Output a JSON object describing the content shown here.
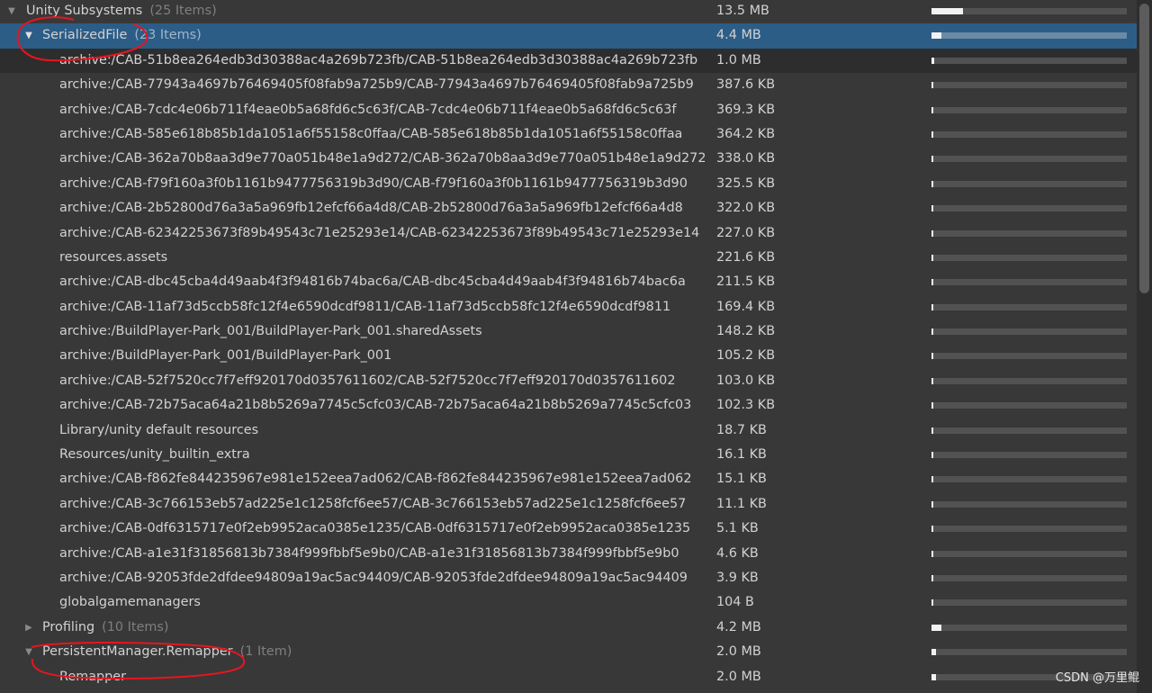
{
  "root": {
    "label": "Unity Subsystems",
    "count": "(25 Items)",
    "size": "13.5 MB",
    "usage": 0.16
  },
  "serialized": {
    "label": "SerializedFile",
    "count": "(23 Items)",
    "size": "4.4 MB",
    "usage": 0.05
  },
  "files": [
    {
      "name": "archive:/CAB-51b8ea264edb3d30388ac4a269b723fb/CAB-51b8ea264edb3d30388ac4a269b723fb",
      "size": "1.0 MB",
      "usage": 0.012
    },
    {
      "name": "archive:/CAB-77943a4697b76469405f08fab9a725b9/CAB-77943a4697b76469405f08fab9a725b9",
      "size": "387.6 KB",
      "usage": 0.006
    },
    {
      "name": "archive:/CAB-7cdc4e06b711f4eae0b5a68fd6c5c63f/CAB-7cdc4e06b711f4eae0b5a68fd6c5c63f",
      "size": "369.3 KB",
      "usage": 0.006
    },
    {
      "name": "archive:/CAB-585e618b85b1da1051a6f55158c0ffaa/CAB-585e618b85b1da1051a6f55158c0ffaa",
      "size": "364.2 KB",
      "usage": 0.006
    },
    {
      "name": "archive:/CAB-362a70b8aa3d9e770a051b48e1a9d272/CAB-362a70b8aa3d9e770a051b48e1a9d272",
      "size": "338.0 KB",
      "usage": 0.006
    },
    {
      "name": "archive:/CAB-f79f160a3f0b1161b9477756319b3d90/CAB-f79f160a3f0b1161b9477756319b3d90",
      "size": "325.5 KB",
      "usage": 0.006
    },
    {
      "name": "archive:/CAB-2b52800d76a3a5a969fb12efcf66a4d8/CAB-2b52800d76a3a5a969fb12efcf66a4d8",
      "size": "322.0 KB",
      "usage": 0.006
    },
    {
      "name": "archive:/CAB-62342253673f89b49543c71e25293e14/CAB-62342253673f89b49543c71e25293e14",
      "size": "227.0 KB",
      "usage": 0.005
    },
    {
      "name": "resources.assets",
      "size": "221.6 KB",
      "usage": 0.005
    },
    {
      "name": "archive:/CAB-dbc45cba4d49aab4f3f94816b74bac6a/CAB-dbc45cba4d49aab4f3f94816b74bac6a",
      "size": "211.5 KB",
      "usage": 0.005
    },
    {
      "name": "archive:/CAB-11af73d5ccb58fc12f4e6590dcdf9811/CAB-11af73d5ccb58fc12f4e6590dcdf9811",
      "size": "169.4 KB",
      "usage": 0.005
    },
    {
      "name": "archive:/BuildPlayer-Park_001/BuildPlayer-Park_001.sharedAssets",
      "size": "148.2 KB",
      "usage": 0.005
    },
    {
      "name": "archive:/BuildPlayer-Park_001/BuildPlayer-Park_001",
      "size": "105.2 KB",
      "usage": 0.005
    },
    {
      "name": "archive:/CAB-52f7520cc7f7eff920170d0357611602/CAB-52f7520cc7f7eff920170d0357611602",
      "size": "103.0 KB",
      "usage": 0.005
    },
    {
      "name": "archive:/CAB-72b75aca64a21b8b5269a7745c5cfc03/CAB-72b75aca64a21b8b5269a7745c5cfc03",
      "size": "102.3 KB",
      "usage": 0.005
    },
    {
      "name": "Library/unity default resources",
      "size": "18.7 KB",
      "usage": 0.004
    },
    {
      "name": "Resources/unity_builtin_extra",
      "size": "16.1 KB",
      "usage": 0.004
    },
    {
      "name": "archive:/CAB-f862fe844235967e981e152eea7ad062/CAB-f862fe844235967e981e152eea7ad062",
      "size": "15.1 KB",
      "usage": 0.004
    },
    {
      "name": "archive:/CAB-3c766153eb57ad225e1c1258fcf6ee57/CAB-3c766153eb57ad225e1c1258fcf6ee57",
      "size": "11.1 KB",
      "usage": 0.004
    },
    {
      "name": "archive:/CAB-0df6315717e0f2eb9952aca0385e1235/CAB-0df6315717e0f2eb9952aca0385e1235",
      "size": "5.1 KB",
      "usage": 0.004
    },
    {
      "name": "archive:/CAB-a1e31f31856813b7384f999fbbf5e9b0/CAB-a1e31f31856813b7384f999fbbf5e9b0",
      "size": "4.6 KB",
      "usage": 0.004
    },
    {
      "name": "archive:/CAB-92053fde2dfdee94809a19ac5ac94409/CAB-92053fde2dfdee94809a19ac5ac94409",
      "size": "3.9 KB",
      "usage": 0.004
    },
    {
      "name": "globalgamemanagers",
      "size": "104 B",
      "usage": 0.004
    }
  ],
  "profiling": {
    "label": "Profiling",
    "count": "(10 Items)",
    "size": "4.2 MB",
    "usage": 0.05
  },
  "remapper_group": {
    "label": "PersistentManager.Remapper",
    "count": "(1 Item)",
    "size": "2.0 MB",
    "usage": 0.025
  },
  "remapper": {
    "label": "Remapper",
    "size": "2.0 MB",
    "usage": 0.025
  },
  "icons": {
    "expanded": "triangle-down-icon",
    "collapsed": "triangle-right-icon"
  },
  "colors": {
    "background": "#383838",
    "selection": "#2c5d87",
    "annotation": "#e8151f",
    "bar_fill": "#f2f2f2"
  },
  "watermark": "CSDN @万里鲲"
}
